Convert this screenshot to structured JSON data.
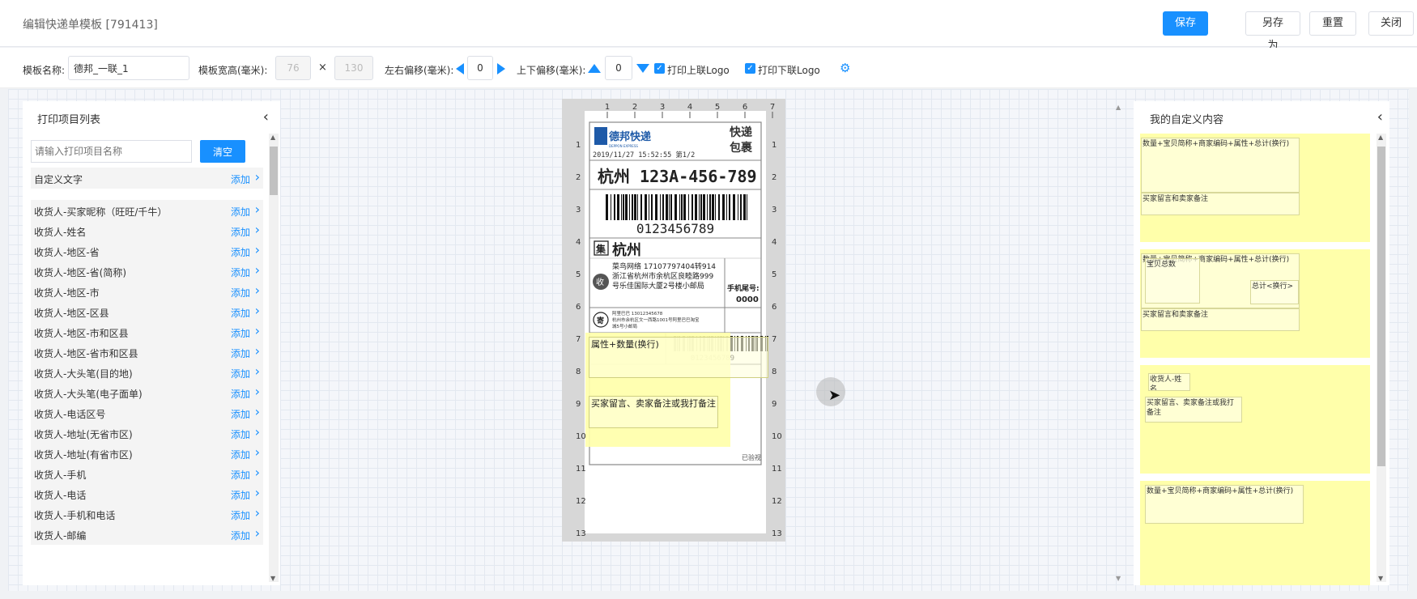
{
  "header": {
    "title": "编辑快递单模板 [791413]",
    "buttons": {
      "save": "保存",
      "save_as": "另存为",
      "reset": "重置",
      "close": "关闭"
    }
  },
  "toolbar": {
    "name_label": "模板名称:",
    "name_value": "德邦_一联_1",
    "size_label": "模板宽高(毫米):",
    "width": "76",
    "height": "130",
    "times": "×",
    "lr_label": "左右偏移(毫米):",
    "lr_value": "0",
    "ud_label": "上下偏移(毫米):",
    "ud_value": "0",
    "print_top_logo": "打印上联Logo",
    "print_bottom_logo": "打印下联Logo",
    "accent": "#1890ff"
  },
  "left_panel": {
    "title": "打印项目列表",
    "search_placeholder": "请输入打印项目名称",
    "clear_btn": "清空",
    "add_label": "添加",
    "custom_item": "自定义文字",
    "items": [
      "收货人-买家昵称（旺旺/千牛）",
      "收货人-姓名",
      "收货人-地区-省",
      "收货人-地区-省(简称)",
      "收货人-地区-市",
      "收货人-地区-区县",
      "收货人-地区-市和区县",
      "收货人-地区-省市和区县",
      "收货人-大头笔(目的地)",
      "收货人-大头笔(电子面单)",
      "收货人-电话区号",
      "收货人-地址(无省市区)",
      "收货人-地址(有省市区)",
      "收货人-手机",
      "收货人-电话",
      "收货人-手机和电话",
      "收货人-邮编"
    ]
  },
  "label": {
    "brand": "德邦快递",
    "brand_en": "DEPPON EXPRESS",
    "kuaidi": "快递",
    "baoguo": "包裹",
    "datetime": "2019/11/27 15:52:55  第1/2",
    "route": "杭州  123A-456-789",
    "barcode_num": "0123456789",
    "ji_char": "集",
    "ji_city": "杭州",
    "shou_char": "收",
    "receiver_name": "菜鸟网络  17107797404转914",
    "receiver_addr1": "浙江省杭州市余杭区良睦路999",
    "receiver_addr2": "号乐佳国际大厦2号楼小邮局",
    "phone_tail_label": "手机尾号:",
    "phone_tail": "0000",
    "ji2_char": "寄",
    "sender_name": "阿里巴巴  13012345678",
    "sender_addr1": "杭州市余杭区文一西路1001号阿里巴巴淘宝",
    "sender_addr2": "城5号小邮局",
    "barcode2_num": "0123456789",
    "yijianshi": "已验视",
    "ruler_top": [
      "1",
      "2",
      "3",
      "4",
      "5",
      "6",
      "7"
    ],
    "ruler_side": [
      "1",
      "2",
      "3",
      "4",
      "5",
      "6",
      "7",
      "8",
      "9",
      "10",
      "11",
      "12",
      "13"
    ],
    "field1": "属性+数量(换行)",
    "field2": "买家留言、卖家备注或我打备注"
  },
  "right_panel": {
    "title": "我的自定义内容",
    "block1_f1": "数量+宝贝简称+商家编码+属性+总计(换行)",
    "block1_f2": "买家留言和卖家备注",
    "block2_f1": "数量+宝贝简称+商家编码+属性+总计(换行)",
    "block2_f2": "宝贝总数",
    "block2_f3": "总计<换行>",
    "block2_f4": "买家留言和卖家备注",
    "block3_f1": "收货人-姓名",
    "block3_f2": "买家留言、卖家备注或我打备注",
    "block4_f1": "数量+宝贝简称+商家编码+属性+总计(换行)"
  }
}
